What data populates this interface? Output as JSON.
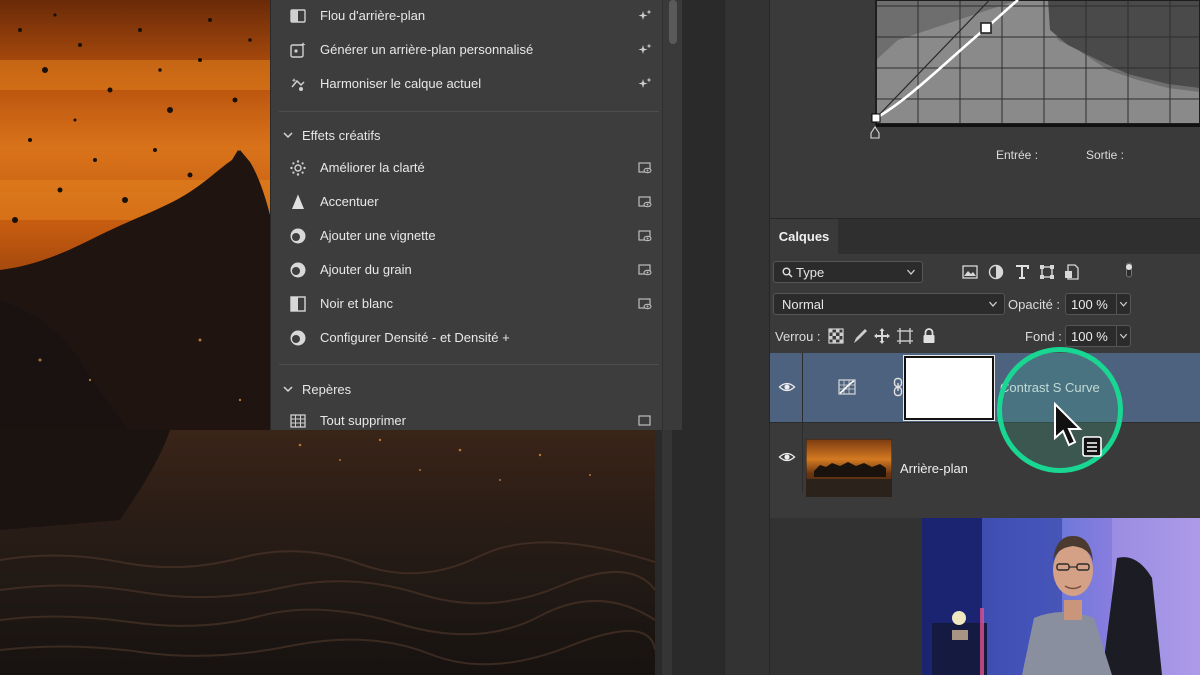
{
  "quick_actions": {
    "items_top": [
      {
        "id": "flou",
        "label": "Flou d'arrière-plan",
        "icon": "background-blur-icon",
        "tail": "sparkle-icon"
      },
      {
        "id": "generer",
        "label": "Générer un arrière-plan personnalisé",
        "icon": "generate-background-icon",
        "tail": "sparkle-icon"
      },
      {
        "id": "harmoniser",
        "label": "Harmoniser le calque actuel",
        "icon": "harmonize-icon",
        "tail": "sparkle-icon"
      }
    ],
    "section_effets": {
      "label": "Effets créatifs",
      "expanded": true
    },
    "items_effets": [
      {
        "id": "clarte",
        "label": "Améliorer la clarté",
        "icon": "clarity-icon",
        "tail": "preview-icon"
      },
      {
        "id": "accentuer",
        "label": "Accentuer",
        "icon": "sharpen-icon",
        "tail": "preview-icon"
      },
      {
        "id": "vignette",
        "label": "Ajouter une vignette",
        "icon": "vignette-icon",
        "tail": "preview-icon"
      },
      {
        "id": "grain",
        "label": "Ajouter du grain",
        "icon": "grain-icon",
        "tail": "preview-icon"
      },
      {
        "id": "noir-blanc",
        "label": "Noir et blanc",
        "icon": "black-white-icon",
        "tail": "preview-icon"
      },
      {
        "id": "densite",
        "label": "Configurer Densité - et Densité +",
        "icon": "dodge-burn-icon",
        "tail": ""
      }
    ],
    "section_reperes": {
      "label": "Repères",
      "expanded": true
    },
    "items_reperes": [
      {
        "id": "tout-supprimer",
        "label": "Tout supprimer",
        "icon": "grid-icon",
        "tail": "preview-icon"
      }
    ]
  },
  "properties": {
    "entree_label": "Entrée :",
    "sortie_label": "Sortie :"
  },
  "layers_panel": {
    "tab_label": "Calques",
    "filter": {
      "value": "Type",
      "icon": "search-icon"
    },
    "blend_mode": "Normal",
    "opacity_label": "Opacité :",
    "opacity_value": "100 %",
    "lock_label": "Verrou :",
    "fill_label": "Fond :",
    "fill_value": "100 %",
    "layers": [
      {
        "name": "Contrast S Curve",
        "type": "curves-adjustment",
        "visible": true,
        "selected": true
      },
      {
        "name": "Arrière-plan",
        "type": "pixel",
        "visible": true,
        "selected": false
      }
    ]
  },
  "colors": {
    "accent_ring": "#19d693",
    "selected_layer": "#4d627e",
    "panel_bg": "#3d3d3d"
  }
}
